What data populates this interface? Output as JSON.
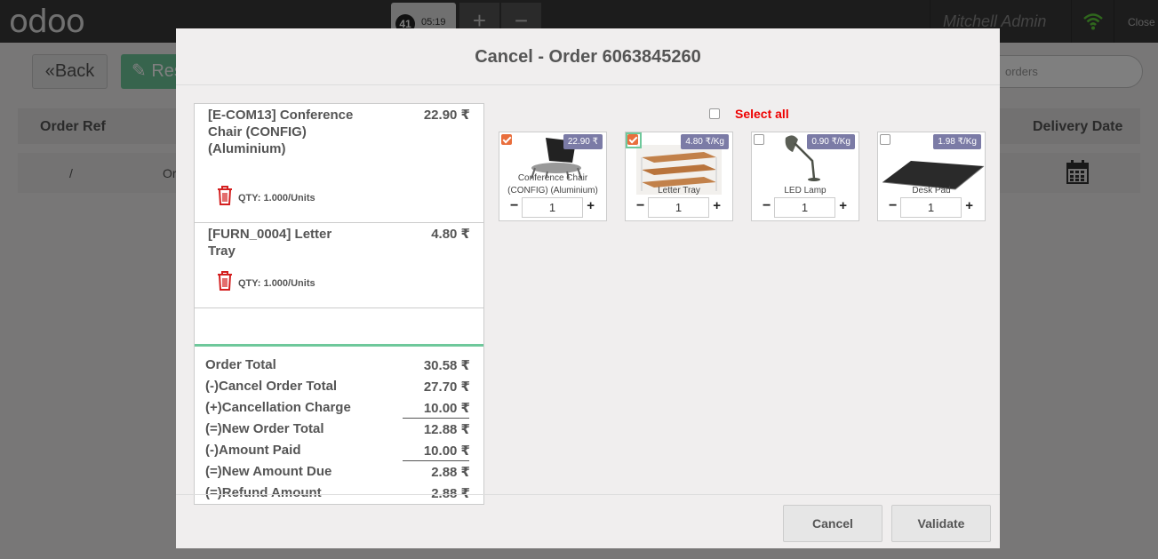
{
  "topbar": {
    "logo": "odoo",
    "order_number": "41",
    "order_time": "05:19",
    "add_label": "+",
    "remove_label": "−",
    "user_name": "Mitchell Admin",
    "close_label": "Close"
  },
  "screen": {
    "back_label": "Back",
    "res_label": "Res",
    "search_placeholder": "orders",
    "columns": {
      "ref": "Order Ref",
      "delivery_date": "Delivery Date"
    },
    "row": {
      "ref": "/",
      "or": "Or"
    }
  },
  "modal": {
    "title": "Cancel - Order 6063845260",
    "lines": [
      {
        "name": "[E-COM13] Conference Chair (CONFIG) (Aluminium)",
        "price": "22.90 ₹",
        "qty": "QTY: 1.000/Units"
      },
      {
        "name": "[FURN_0004] Letter Tray",
        "price": "4.80 ₹",
        "qty": "QTY: 1.000/Units"
      }
    ],
    "totals": [
      {
        "label": "Order Total",
        "value": "30.58 ₹"
      },
      {
        "label": "(-)Cancel Order Total",
        "value": "27.70 ₹"
      },
      {
        "label": "(+)Cancellation Charge",
        "value": "10.00 ₹"
      },
      {
        "label": "(=)New Order Total",
        "value": "12.88 ₹"
      },
      {
        "label": "(-)Amount Paid",
        "value": "10.00 ₹"
      },
      {
        "label": "(=)New Amount Due",
        "value": "2.88 ₹"
      },
      {
        "label": "(=)Refund Amount",
        "value": "2.88 ₹"
      }
    ],
    "select_all_label": "Select all",
    "products": [
      {
        "name": "Conference Chair (CONFIG) (Aluminium)",
        "price": "22.90 ₹",
        "qty": "1",
        "checked": true
      },
      {
        "name": "Letter Tray",
        "price": "4.80 ₹/Kg",
        "qty": "1",
        "checked": true
      },
      {
        "name": "LED Lamp",
        "price": "0.90 ₹/Kg",
        "qty": "1",
        "checked": false
      },
      {
        "name": "Desk Pad",
        "price": "1.98 ₹/Kg",
        "qty": "1",
        "checked": false
      }
    ],
    "minus_label": "−",
    "plus_label": "+",
    "cancel_label": "Cancel",
    "validate_label": "Validate"
  },
  "colors": {
    "accent": "#6ec89b",
    "price_badge": "#7b7ba6",
    "check": "#e96e3c",
    "select_all": "#ee0000",
    "topbar": "#393939"
  }
}
